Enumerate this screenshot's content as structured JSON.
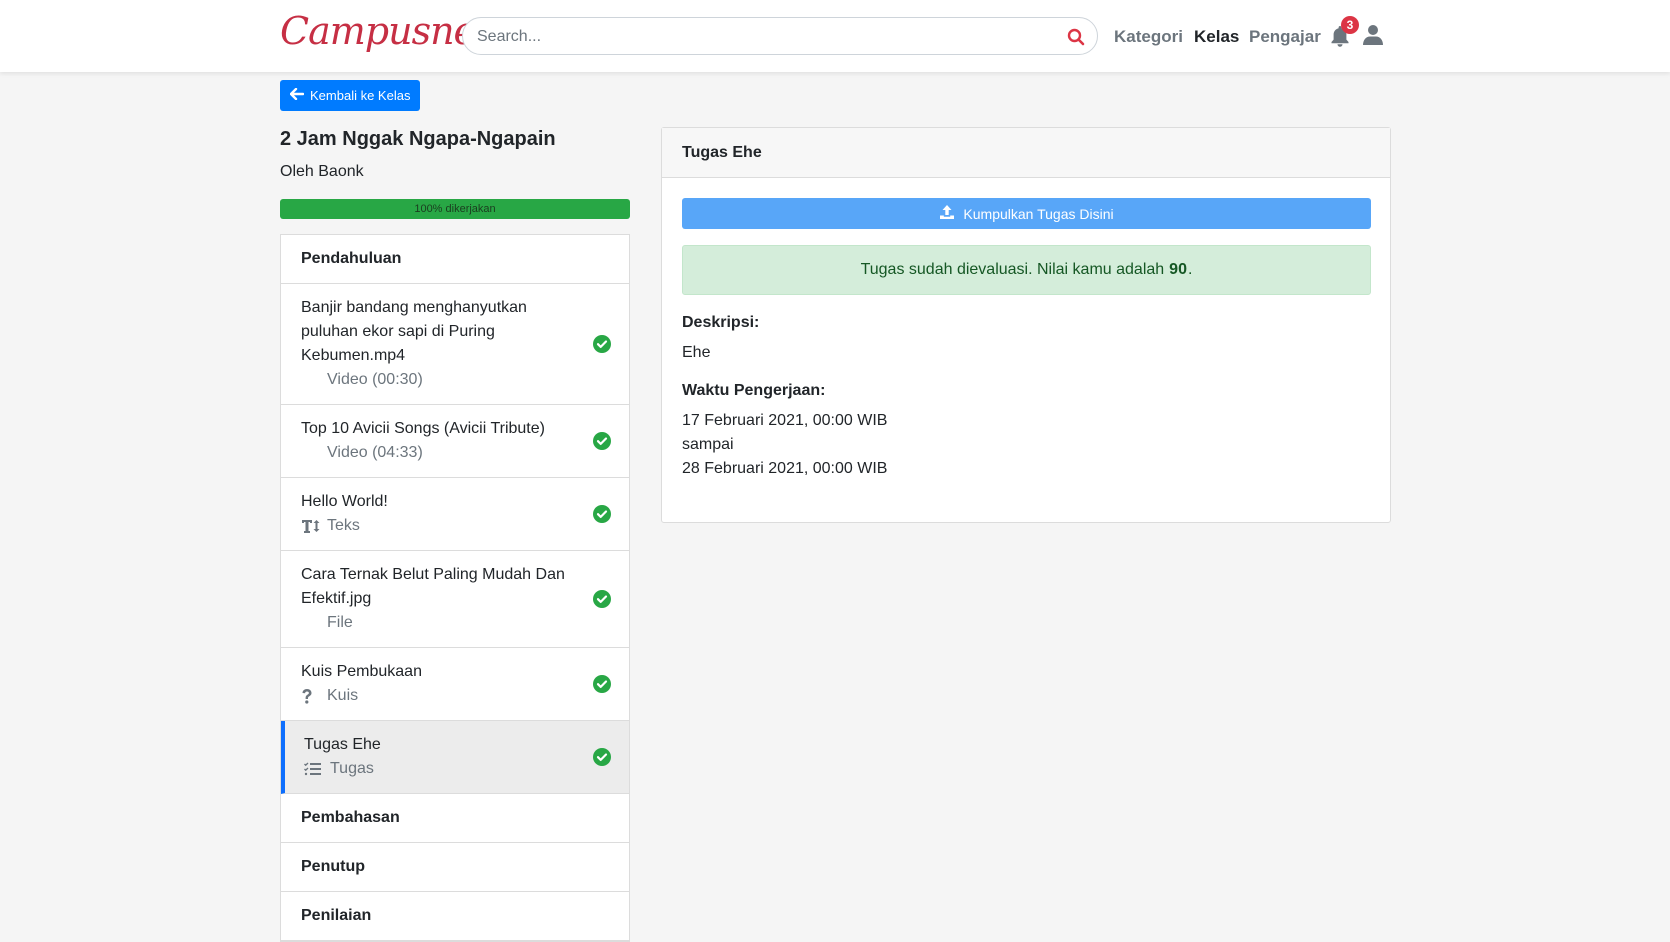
{
  "navbar": {
    "logo": "Campusnet",
    "search_placeholder": "Search...",
    "links": [
      "Kategori",
      "Kelas",
      "Pengajar"
    ],
    "notification_count": "3"
  },
  "back_button": "Kembali ke Kelas",
  "course": {
    "title": "2 Jam Nggak Ngapa-Ngapain",
    "author": "Oleh Baonk",
    "progress_label": "100% dikerjakan",
    "progress_percent": 100
  },
  "sections": {
    "pendahuluan": "Pendahuluan",
    "pembahasan": "Pembahasan",
    "penutup": "Penutup",
    "penilaian": "Penilaian"
  },
  "items": [
    {
      "title": "Banjir bandang menghanyutkan puluhan ekor sapi di Puring Kebumen.mp4",
      "type": "Video (00:30)",
      "icon": "none"
    },
    {
      "title": "Top 10 Avicii Songs (Avicii Tribute)",
      "type": "Video (04:33)",
      "icon": "none"
    },
    {
      "title": "Hello World!",
      "type": "Teks",
      "icon": "text-height-icon"
    },
    {
      "title": "Cara Ternak Belut Paling Mudah Dan Efektif.jpg",
      "type": "File",
      "icon": "none"
    },
    {
      "title": "Kuis Pembukaan",
      "type": "Kuis",
      "icon": "question-icon"
    },
    {
      "title": "Tugas Ehe",
      "type": "Tugas",
      "icon": "tasks-icon"
    }
  ],
  "assignment": {
    "header": "Tugas Ehe",
    "submit_button": "Kumpulkan Tugas Disini",
    "alert_prefix": "Tugas sudah dievaluasi. Nilai kamu adalah",
    "score": "90",
    "alert_suffix": ".",
    "description_label": "Deskripsi:",
    "description": "Ehe",
    "time_label": "Waktu Pengerjaan:",
    "start": "17 Februari 2021, 00:00 WIB",
    "until": "sampai",
    "end": "28 Februari 2021, 00:00 WIB"
  },
  "colors": {
    "brand": "#c62f44",
    "primary": "#007bff",
    "success": "#28a745"
  }
}
